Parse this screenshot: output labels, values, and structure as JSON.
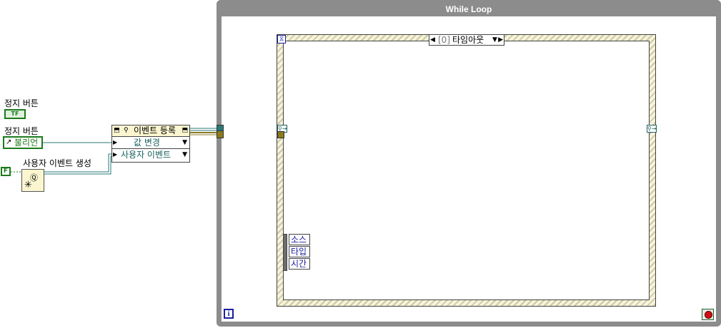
{
  "while_loop": {
    "title": "While Loop",
    "iteration_label": "i"
  },
  "event_structure": {
    "case_index": "[0]",
    "case_name": "타임아웃",
    "event_data_items": [
      "소스",
      "타입",
      "시간"
    ]
  },
  "controls": {
    "stop_button_label_1": "정지 버튼",
    "stop_button_tf": "TF",
    "stop_button_label_2": "정지 버튼",
    "stop_ref_text": "불리언",
    "false_constant": "F",
    "create_user_event_label": "사용자 이벤트 생성"
  },
  "register_node": {
    "title": "이벤트 등록",
    "rows": [
      {
        "label": "값 변경"
      },
      {
        "label": "사용자 이벤트"
      }
    ]
  },
  "colors": {
    "loop_frame": "#8c8c8c",
    "boolean_wire": "#1c7a1c",
    "refnum_wire": "#2a7a7a",
    "event_wire": "#8a7a20"
  }
}
